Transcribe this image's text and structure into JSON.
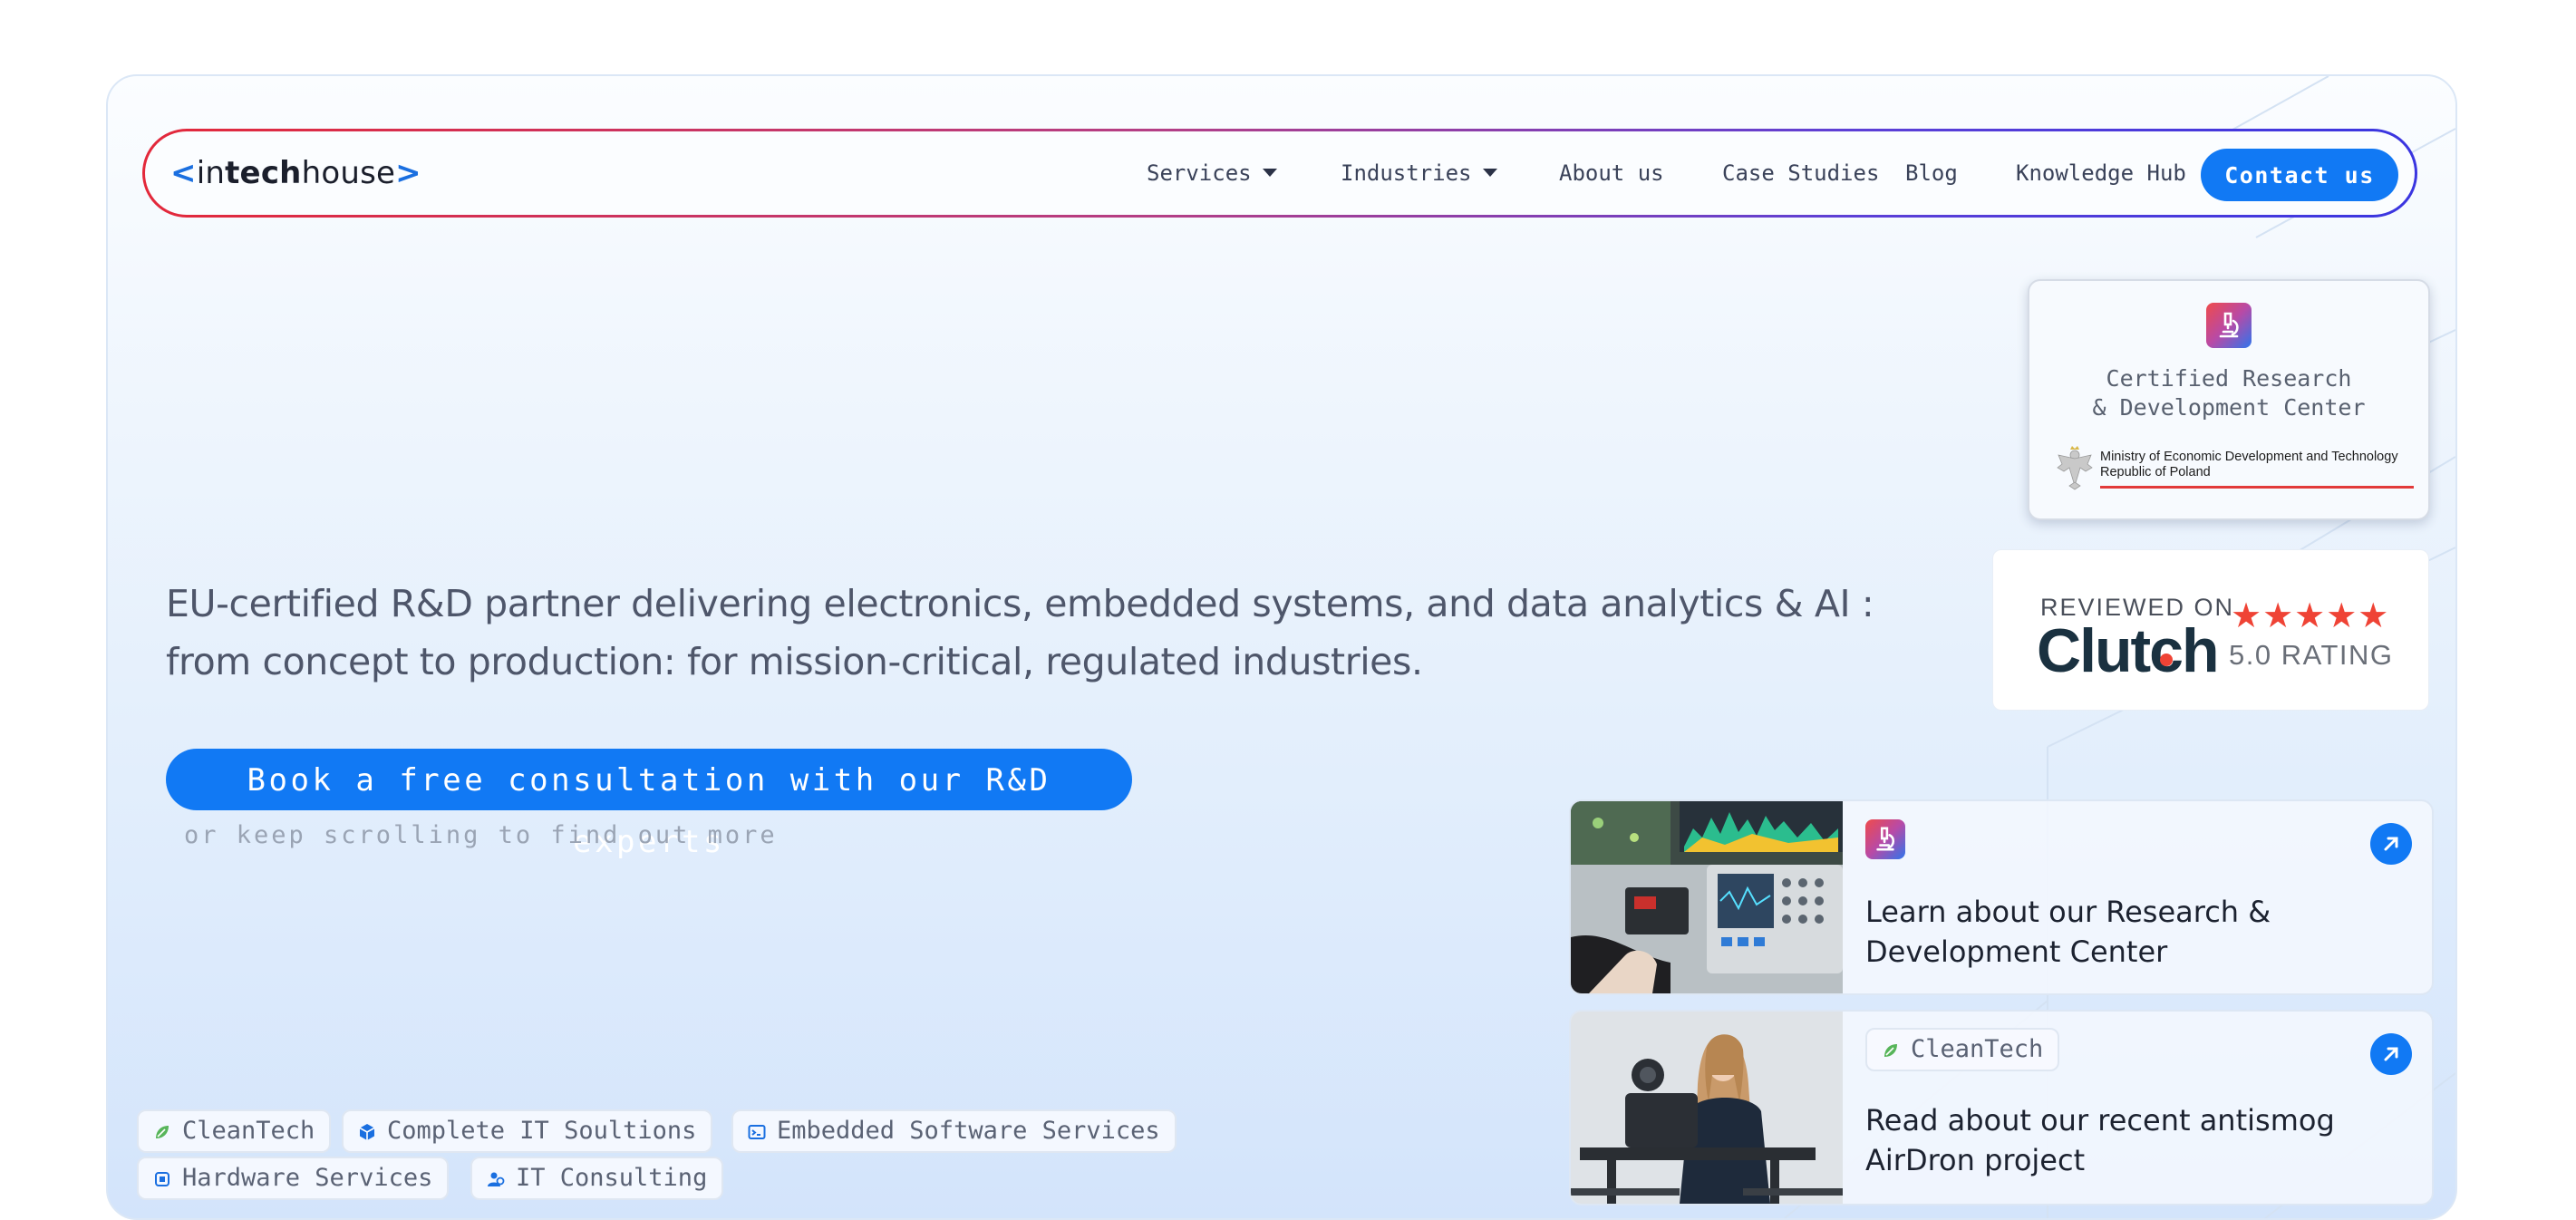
{
  "nav": {
    "logo": {
      "open": "<",
      "in": "in",
      "tech": "tech",
      "house": "house",
      "close": ">"
    },
    "links": [
      "Services",
      "Industries",
      "About us",
      "Case Studies",
      "Blog",
      "Knowledge Hub"
    ],
    "contact": "Contact us"
  },
  "cert": {
    "title_line1": "Certified Research",
    "title_line2": "& Development Center",
    "ministry_line1": "Ministry of Economic Development and Technology",
    "ministry_line2": "Republic of Poland"
  },
  "clutch": {
    "reviewed": "REVIEWED ON",
    "brand": "Clutch",
    "stars": "★★★★★",
    "rating": "5.0 RATING"
  },
  "hero": {
    "tagline_line1": "EU-certified R&D partner delivering electronics, embedded systems, and data analytics & AI :",
    "tagline_line2": "from concept to production: for mission-critical, regulated industries.",
    "cta": "Book a free consultation with our R&D experts",
    "scroll_hint": "or keep scrolling to find out more"
  },
  "cards": [
    {
      "line1": "Learn about our Research &",
      "line2": "Development Center"
    },
    {
      "tag": "CleanTech",
      "line1": "Read about our recent antismog",
      "line2": "AirDron project"
    }
  ],
  "chips": [
    "CleanTech",
    "Complete IT Soultions",
    "Embedded Software Services",
    "Hardware Services",
    "IT Consulting"
  ],
  "colors": {
    "accent": "#1179f4",
    "brand_red": "#e3283a",
    "clutch_red": "#ef4335",
    "leaf_green": "#57b55a"
  }
}
